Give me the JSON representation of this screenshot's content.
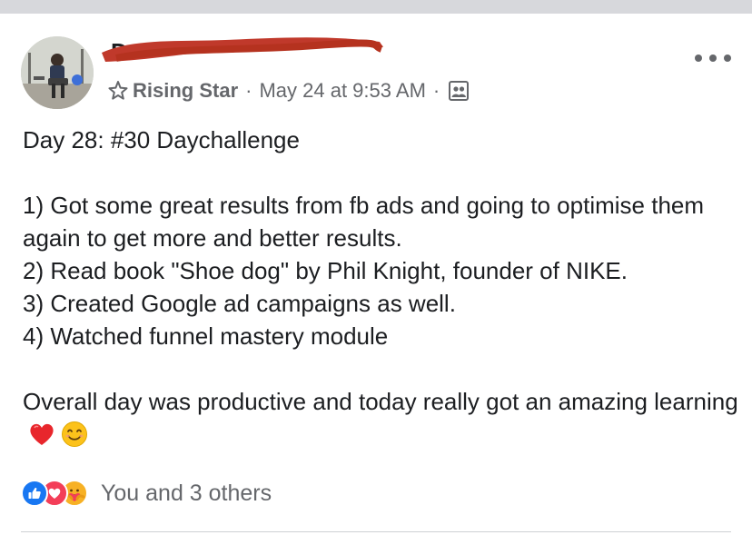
{
  "post": {
    "author": {
      "name_visible": "D",
      "avatar": "avatar-photo"
    },
    "badge": {
      "icon": "rising-star-icon",
      "label": "Rising Star"
    },
    "separator": "·",
    "timestamp": "May 24 at 9:53 AM",
    "audience_icon": "group-audience-icon",
    "more_icon": "more-options-icon",
    "body": {
      "title_line": "Day 28: #30 Daychallenge",
      "items": [
        "1) Got some great results from fb ads and going to optimise them again to get more and better results.",
        "2) Read book \"Shoe dog\" by Phil Knight, founder of NIKE.",
        "3) Created Google ad campaigns as well.",
        "4) Watched funnel mastery module"
      ],
      "closing": "Overall day was productive and today really got an amazing learning",
      "emojis": [
        "red-heart-emoji",
        "smiling-face-emoji"
      ]
    },
    "reactions": {
      "icons": [
        "like-icon",
        "love-icon",
        "care-icon"
      ],
      "text": "You and 3 others"
    }
  },
  "colors": {
    "text": "#1c1e21",
    "meta": "#65676b",
    "like": "#1877f2",
    "love": "#f33e58",
    "care": "#f7b125",
    "redaction": "#c0392b"
  }
}
